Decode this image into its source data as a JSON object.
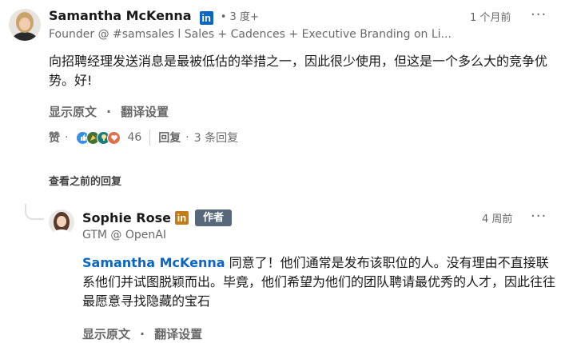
{
  "main_comment": {
    "author": "Samantha McKenna",
    "degree": "• 3 度+",
    "headline": "Founder @ #samsales l Sales + Cadences + Executive Branding on Li...",
    "time": "1 个月前",
    "more_icon": "ellipsis-icon",
    "body": "向招聘经理发送消息是最被低估的举措之一，因此很少使用，但这是一个多么大的竞争优势。好!",
    "show_original": "显示原文",
    "separator": "·",
    "translate_settings": "翻译设置",
    "like_label": "赞",
    "dot": "·",
    "reactions": [
      "like-icon",
      "celebrate-icon",
      "insightful-icon",
      "love-icon"
    ],
    "reaction_count": "46",
    "reply_label": "回复",
    "reply_count": "3 条回复"
  },
  "prev_replies_label": "查看之前的回复",
  "reply": {
    "author": "Sophie Rose",
    "badge": "作者",
    "headline": "GTM @ OpenAI",
    "time": "4 周前",
    "mention": "Samantha McKenna",
    "body": " 同意了！他们通常是发布该职位的人。没有理由不直接联系他们并试图脱颖而出。毕竟，他们希望为他们的团队聘请最优秀的人才，因此往往最愿意寻找隐藏的宝石",
    "show_original": "显示原文",
    "separator": "·",
    "translate_settings": "翻译设置"
  },
  "colors": {
    "linkedin_blue": "#0a66c2",
    "author_badge_bg": "#56687a",
    "mention_color": "#0a66c2"
  }
}
